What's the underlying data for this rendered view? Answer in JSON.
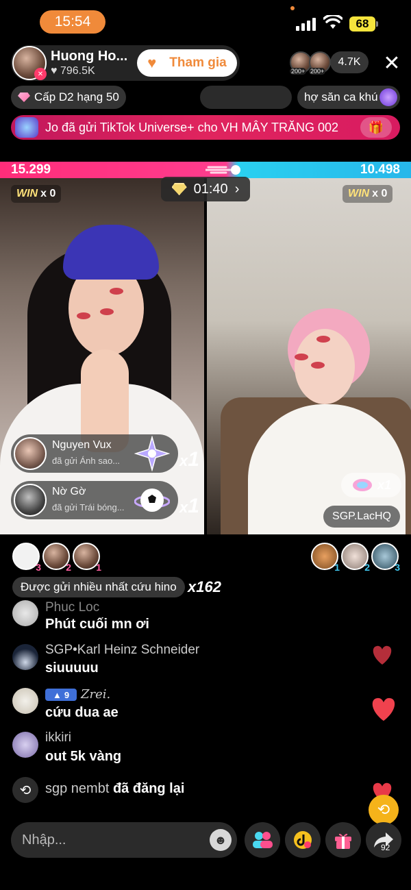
{
  "status_bar": {
    "time": "15:54",
    "battery": "68"
  },
  "host": {
    "name": "Huong Ho...",
    "likes": "796.5K",
    "join_label": "Tham gia"
  },
  "viewers": {
    "badges": [
      "200+",
      "200+"
    ],
    "count": "4.7K"
  },
  "chips": {
    "level": "Cấp D2 hạng 50",
    "hunt": "hợ săn ca khú"
  },
  "banner": {
    "text": "Jo đã gửi TikTok Universe+ cho VH MÂY TRĂNG 002"
  },
  "battle": {
    "left_score": "15.299",
    "right_score": "10.498",
    "timer": "01:40",
    "timer_chevron": "›",
    "win_label": "WIN",
    "left_wins": "x 0",
    "right_wins": "x 0"
  },
  "gifts": [
    {
      "name": "Nguyen Vux",
      "sub": "đã gửi Ánh sao...",
      "mult_x": "x",
      "mult_n": "1"
    },
    {
      "name": "Nờ Gờ",
      "sub": "đã gửi Trái bóng...",
      "mult_x": "x",
      "mult_n": "1"
    }
  ],
  "right_panel": {
    "gift_mult": "x1",
    "user": "SGP.LacHQ"
  },
  "rank_left": [
    "3",
    "2",
    "1"
  ],
  "rank_right": [
    "1",
    "2",
    "3"
  ],
  "most_sent": {
    "label": "Được gửi nhiều nhất",
    "gift": "cứu hino",
    "mult": "x162"
  },
  "chat": [
    {
      "name": "Phuc Loc",
      "msg": "Phút cuối mn ơi"
    },
    {
      "name": "SGP•Karl Heinz Schneider",
      "msg": "siuuuuu"
    },
    {
      "name": "Zrei.",
      "level": "9",
      "msg": "cứu dua ae"
    },
    {
      "name": "ikkiri",
      "msg": "out 5k vàng"
    }
  ],
  "repost": {
    "user": "sgp nembt",
    "action": "đã đăng lại"
  },
  "input": {
    "placeholder": "Nhập..."
  },
  "share_count": "92",
  "colors": {
    "accent_orange": "#f08a3a",
    "battle_pink": "#ff2d7a",
    "battle_blue": "#2ad0f0",
    "banner_red": "#e0245e"
  }
}
